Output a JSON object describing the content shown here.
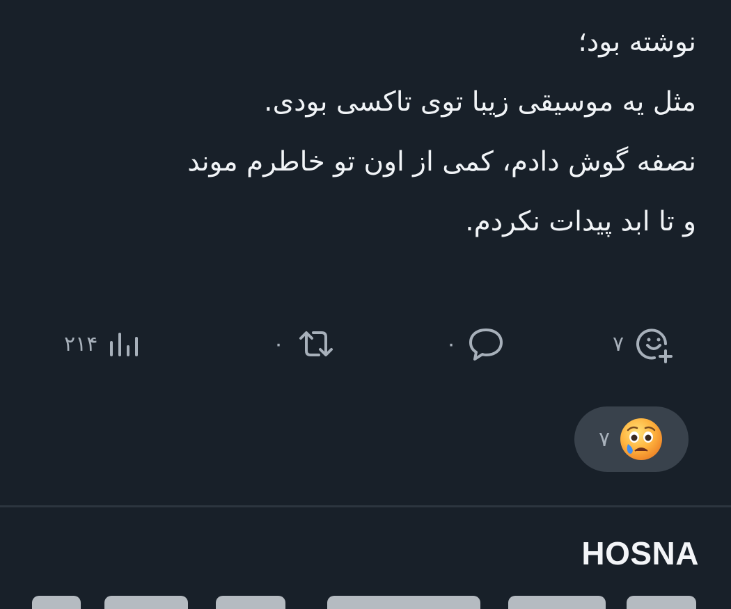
{
  "post": {
    "lines": [
      "نوشته بود؛",
      "مثل یه موسیقی زیبا توی تاکسی بودی.",
      "نصفه گوش دادم، کمی از اون تو خاطرم موند",
      "و تا ابد پیدات نکردم."
    ]
  },
  "actions": {
    "views": "۲۱۴",
    "reposts": "۰",
    "replies": "۰",
    "reactions": "۷"
  },
  "reaction_pill": {
    "emoji": "sad-tear-face",
    "count": "۷"
  },
  "next_post": {
    "author": "HOSNA"
  },
  "colors": {
    "background": "#182029",
    "text": "#f1f4f7",
    "muted": "#a7b0ba",
    "pill": "#39424c"
  }
}
